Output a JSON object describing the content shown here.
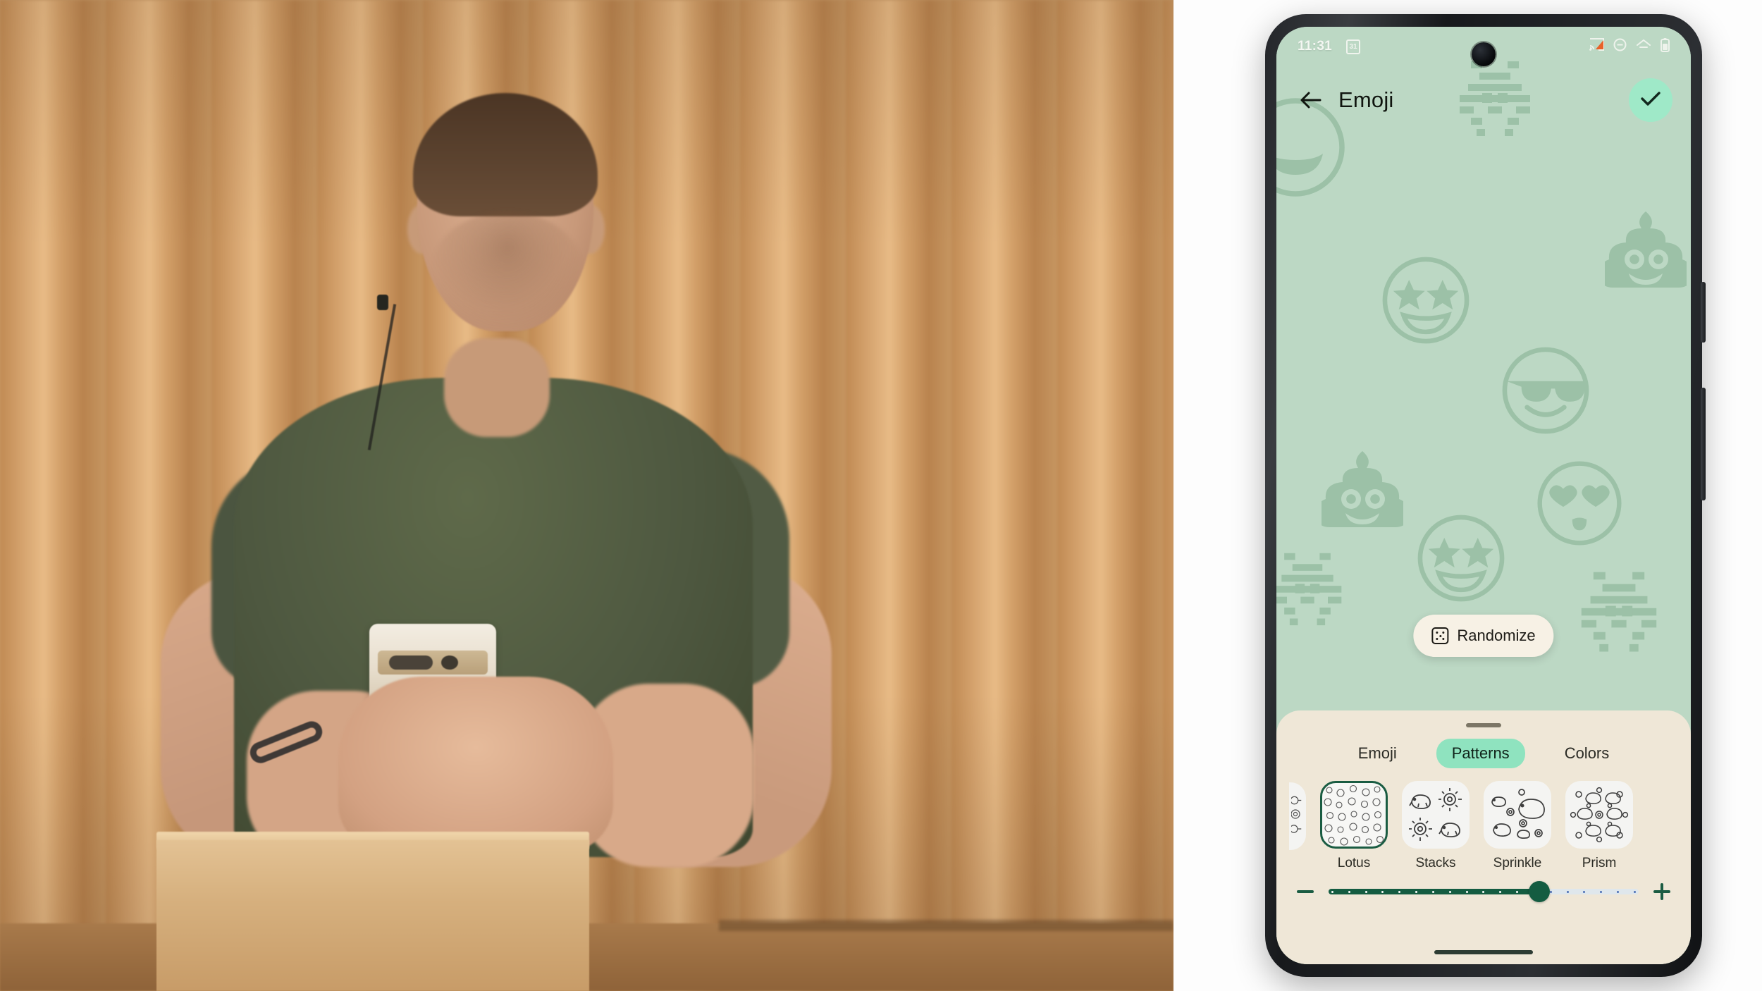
{
  "phone": {
    "status_bar": {
      "time": "11:31",
      "calendar_day": "31",
      "icons": [
        "cast-icon",
        "do-not-disturb-icon",
        "wifi-icon",
        "battery-icon"
      ]
    },
    "app_bar": {
      "back_icon": "arrow-back-icon",
      "title": "Emoji",
      "confirm_icon": "check-icon"
    },
    "randomize": {
      "label": "Randomize",
      "icon": "dice-icon"
    },
    "sheet": {
      "handle": "drag-handle",
      "tabs": [
        {
          "label": "Emoji",
          "active": false
        },
        {
          "label": "Patterns",
          "active": true
        },
        {
          "label": "Colors",
          "active": false
        }
      ],
      "patterns": [
        {
          "label": "Lotus",
          "selected": true
        },
        {
          "label": "Stacks",
          "selected": false
        },
        {
          "label": "Sprinkle",
          "selected": false
        },
        {
          "label": "Prism",
          "selected": false
        }
      ],
      "slider": {
        "minus_label": "Decrease density",
        "plus_label": "Increase density",
        "ticks": 19,
        "value": 13,
        "percent": 68
      }
    },
    "wallpaper": {
      "background_color": "#bcd8c4",
      "motif_color": "#8ab396",
      "emojis": [
        "star-struck-emoji",
        "sunglasses-emoji",
        "pile-of-poo-emoji",
        "heart-eyes-emoji",
        "space-invader-emoji"
      ]
    },
    "colors": {
      "accent_mint": "#9fe9c8",
      "tab_active": "#8fe3bf",
      "sheet_bg": "#efe7d7",
      "chip_bg": "#f7f1e5",
      "slider_fill": "#145c41",
      "selected_border": "#1a5c42"
    }
  },
  "video": {
    "scene": "person-holding-phone-at-wooden-podium",
    "backdrop": "vertical-wood-slat-curtain"
  }
}
